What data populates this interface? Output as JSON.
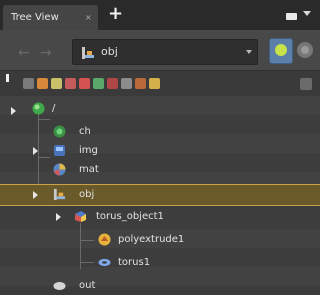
{
  "tab": {
    "title": "Tree View",
    "close": "×",
    "add": "+"
  },
  "path": {
    "value": "obj",
    "icon": "object-icon"
  },
  "toolbar": {
    "buttons": [
      "geo-node-icon",
      "obj-node-icon",
      "camera-icon",
      "light-icon",
      "material-icon",
      "render-icon",
      "chop-icon",
      "cop-icon",
      "dop-icon",
      "top-icon"
    ]
  },
  "tree": {
    "root": {
      "label": "/"
    },
    "items": [
      {
        "label": "ch"
      },
      {
        "label": "img"
      },
      {
        "label": "mat"
      },
      {
        "label": "obj"
      },
      {
        "label": "torus_object1"
      },
      {
        "label": "polyextrude1"
      },
      {
        "label": "torus1"
      },
      {
        "label": "out"
      }
    ]
  },
  "colors": {
    "accent": "#5b7fa8",
    "selection": "#c9a24b"
  }
}
